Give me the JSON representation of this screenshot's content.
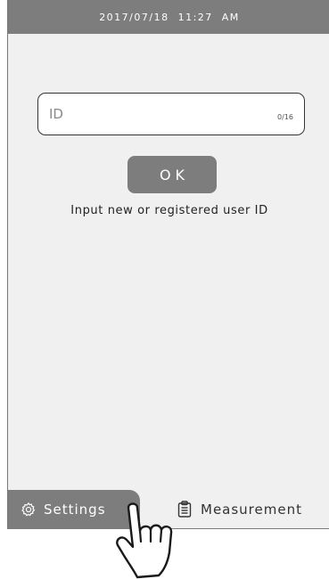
{
  "status_bar": {
    "datetime": "2017/07/18   11:27 AM"
  },
  "id_input": {
    "placeholder": "ID",
    "counter": "0/16"
  },
  "ok_button": {
    "label": "OK"
  },
  "hint": "Input new or registered user ID",
  "tabs": [
    {
      "label": "Settings",
      "icon": "gear-icon",
      "active": true
    },
    {
      "label": "Measurement",
      "icon": "clipboard-icon",
      "active": false
    }
  ],
  "colors": {
    "bar": "#7d7d7d",
    "screen_bg": "#f0f0f0",
    "text": "#222222"
  }
}
